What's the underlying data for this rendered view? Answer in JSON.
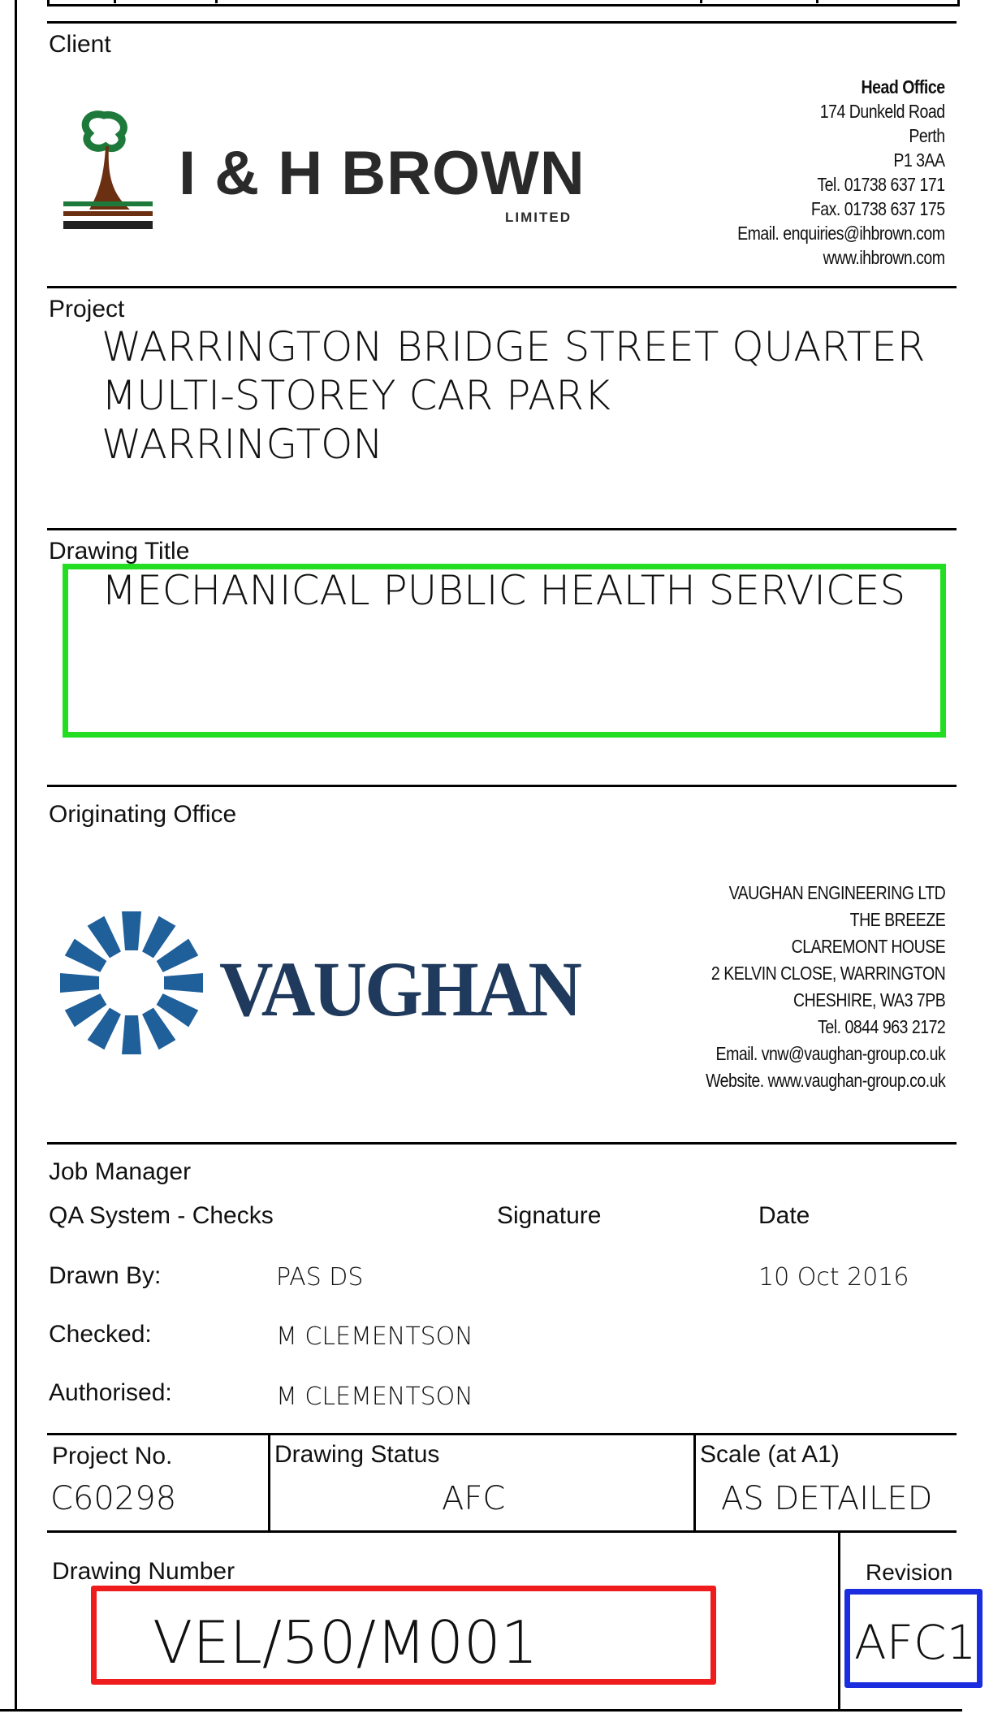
{
  "client": {
    "label": "Client",
    "logo": {
      "name": "I & H BROWN",
      "sub": "LIMITED"
    },
    "address": [
      "Head Office",
      "174 Dunkeld Road",
      "Perth",
      "P1 3AA",
      "Tel. 01738 637 171",
      "Fax. 01738 637 175",
      "Email. enquiries@ihbrown.com",
      "www.ihbrown.com"
    ]
  },
  "project": {
    "label": "Project",
    "lines": [
      "WARRINGTON BRIDGE STREET QUARTER",
      "MULTI-STOREY CAR PARK",
      "WARRINGTON"
    ]
  },
  "drawing_title": {
    "label": "Drawing Title",
    "value": "MECHANICAL PUBLIC HEALTH SERVICES",
    "highlight_color": "#22dd22"
  },
  "originating_office": {
    "label": "Originating Office",
    "logo": {
      "name": "VAUGHAN",
      "color": "#1f3a5c"
    },
    "address": [
      "VAUGHAN ENGINEERING LTD",
      "THE BREEZE",
      "CLAREMONT HOUSE",
      "2 KELVIN CLOSE, WARRINGTON",
      "CHESHIRE, WA3 7PB",
      "Tel. 0844 963 2172",
      "Email. vnw@vaughan-group.co.uk",
      "Website. www.vaughan-group.co.uk"
    ]
  },
  "job": {
    "label": "Job Manager",
    "qa_label": "QA System  - Checks",
    "signature_label": "Signature",
    "date_label": "Date",
    "rows": [
      {
        "label": "Drawn By:",
        "name": "PAS DS",
        "date": "10 Oct 2016"
      },
      {
        "label": "Checked:",
        "name": "M CLEMENTSON",
        "date": ""
      },
      {
        "label": "Authorised:",
        "name": "M CLEMENTSON",
        "date": ""
      }
    ]
  },
  "info": {
    "project_no_label": "Project No.",
    "project_no": "C60298",
    "status_label": "Drawing Status",
    "status": "AFC",
    "scale_label": "Scale (at A1)",
    "scale": "AS DETAILED"
  },
  "drawing_number": {
    "label": "Drawing Number",
    "value": "VEL/50/M001",
    "highlight_color": "#ee1c1c"
  },
  "revision": {
    "label": "Revision",
    "value": "AFC1",
    "highlight_color": "#1a2ee0"
  }
}
